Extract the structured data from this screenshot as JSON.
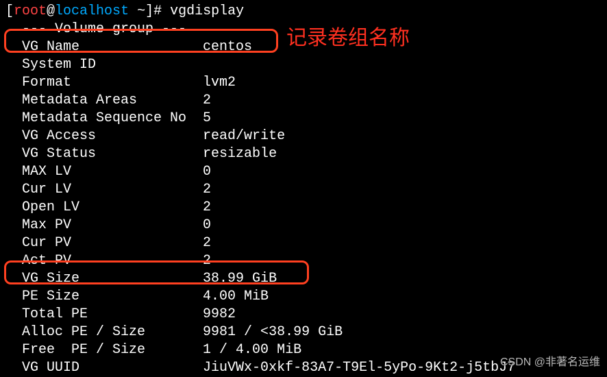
{
  "prompt": {
    "user": "root",
    "at": "@",
    "host": "localhost",
    "path": " ~",
    "suffix": "]# ",
    "command": "vgdisplay"
  },
  "header": "  --- Volume group ---",
  "rows": [
    {
      "label": "VG Name",
      "value": "centos"
    },
    {
      "label": "System ID",
      "value": ""
    },
    {
      "label": "Format",
      "value": "lvm2"
    },
    {
      "label": "Metadata Areas",
      "value": "2"
    },
    {
      "label": "Metadata Sequence No",
      "value": "5"
    },
    {
      "label": "VG Access",
      "value": "read/write"
    },
    {
      "label": "VG Status",
      "value": "resizable"
    },
    {
      "label": "MAX LV",
      "value": "0"
    },
    {
      "label": "Cur LV",
      "value": "2"
    },
    {
      "label": "Open LV",
      "value": "2"
    },
    {
      "label": "Max PV",
      "value": "0"
    },
    {
      "label": "Cur PV",
      "value": "2"
    },
    {
      "label": "Act PV",
      "value": "2"
    },
    {
      "label": "VG Size",
      "value": "38.99 GiB"
    },
    {
      "label": "PE Size",
      "value": "4.00 MiB"
    },
    {
      "label": "Total PE",
      "value": "9982"
    },
    {
      "label": "Alloc PE / Size",
      "value": "9981 / <38.99 GiB"
    },
    {
      "label": "Free  PE / Size",
      "value": "1 / 4.00 MiB"
    },
    {
      "label": "VG UUID",
      "value": "JiuVWx-0xkf-83A7-T9El-5yPo-9Kt2-j5tbJ7"
    }
  ],
  "annotation": "记录卷组名称",
  "watermark": "CSDN @非著名运维"
}
